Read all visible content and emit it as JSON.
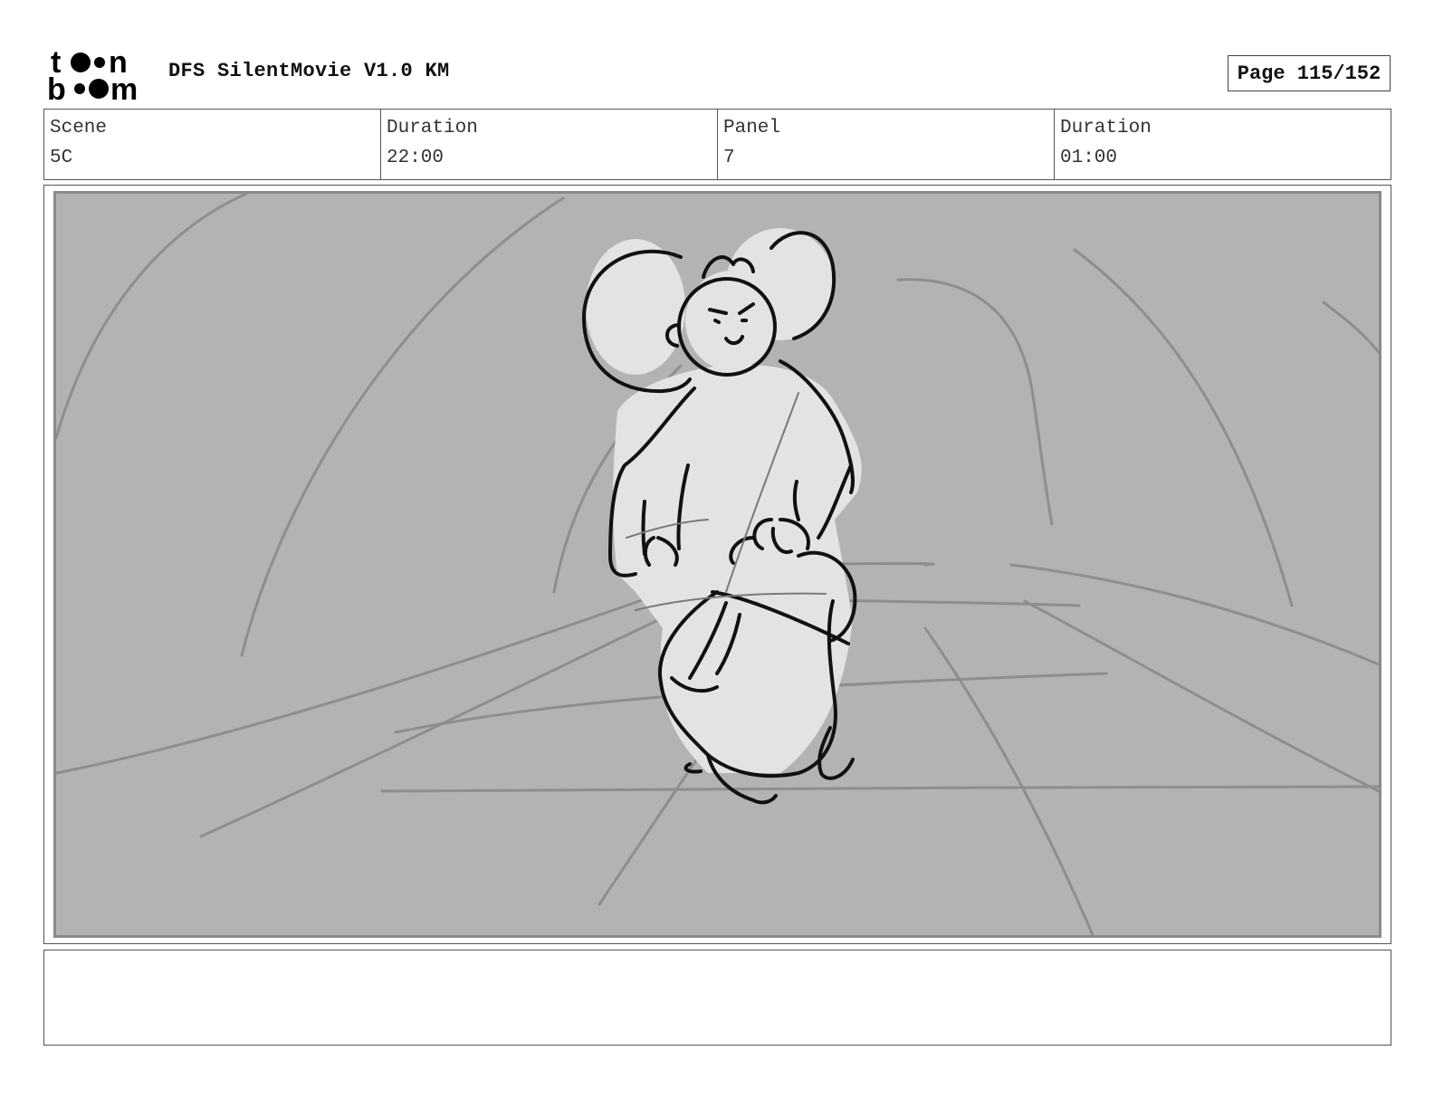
{
  "header": {
    "logo_text": "toon boom",
    "title": "DFS SilentMovie V1.0 KM",
    "page": "Page 115/152"
  },
  "info": {
    "scene_label": "Scene",
    "scene_value": "5C",
    "scene_duration_label": "Duration",
    "scene_duration_value": "22:00",
    "panel_label": "Panel",
    "panel_value": "7",
    "panel_duration_label": "Duration",
    "panel_duration_value": "01:00"
  },
  "panel": {
    "background_color": "#b3b3b3",
    "figure_fill": "#e3e3e3",
    "line_color": "#111111",
    "guide_color": "#8e8e8e"
  },
  "notes": {
    "text": ""
  }
}
